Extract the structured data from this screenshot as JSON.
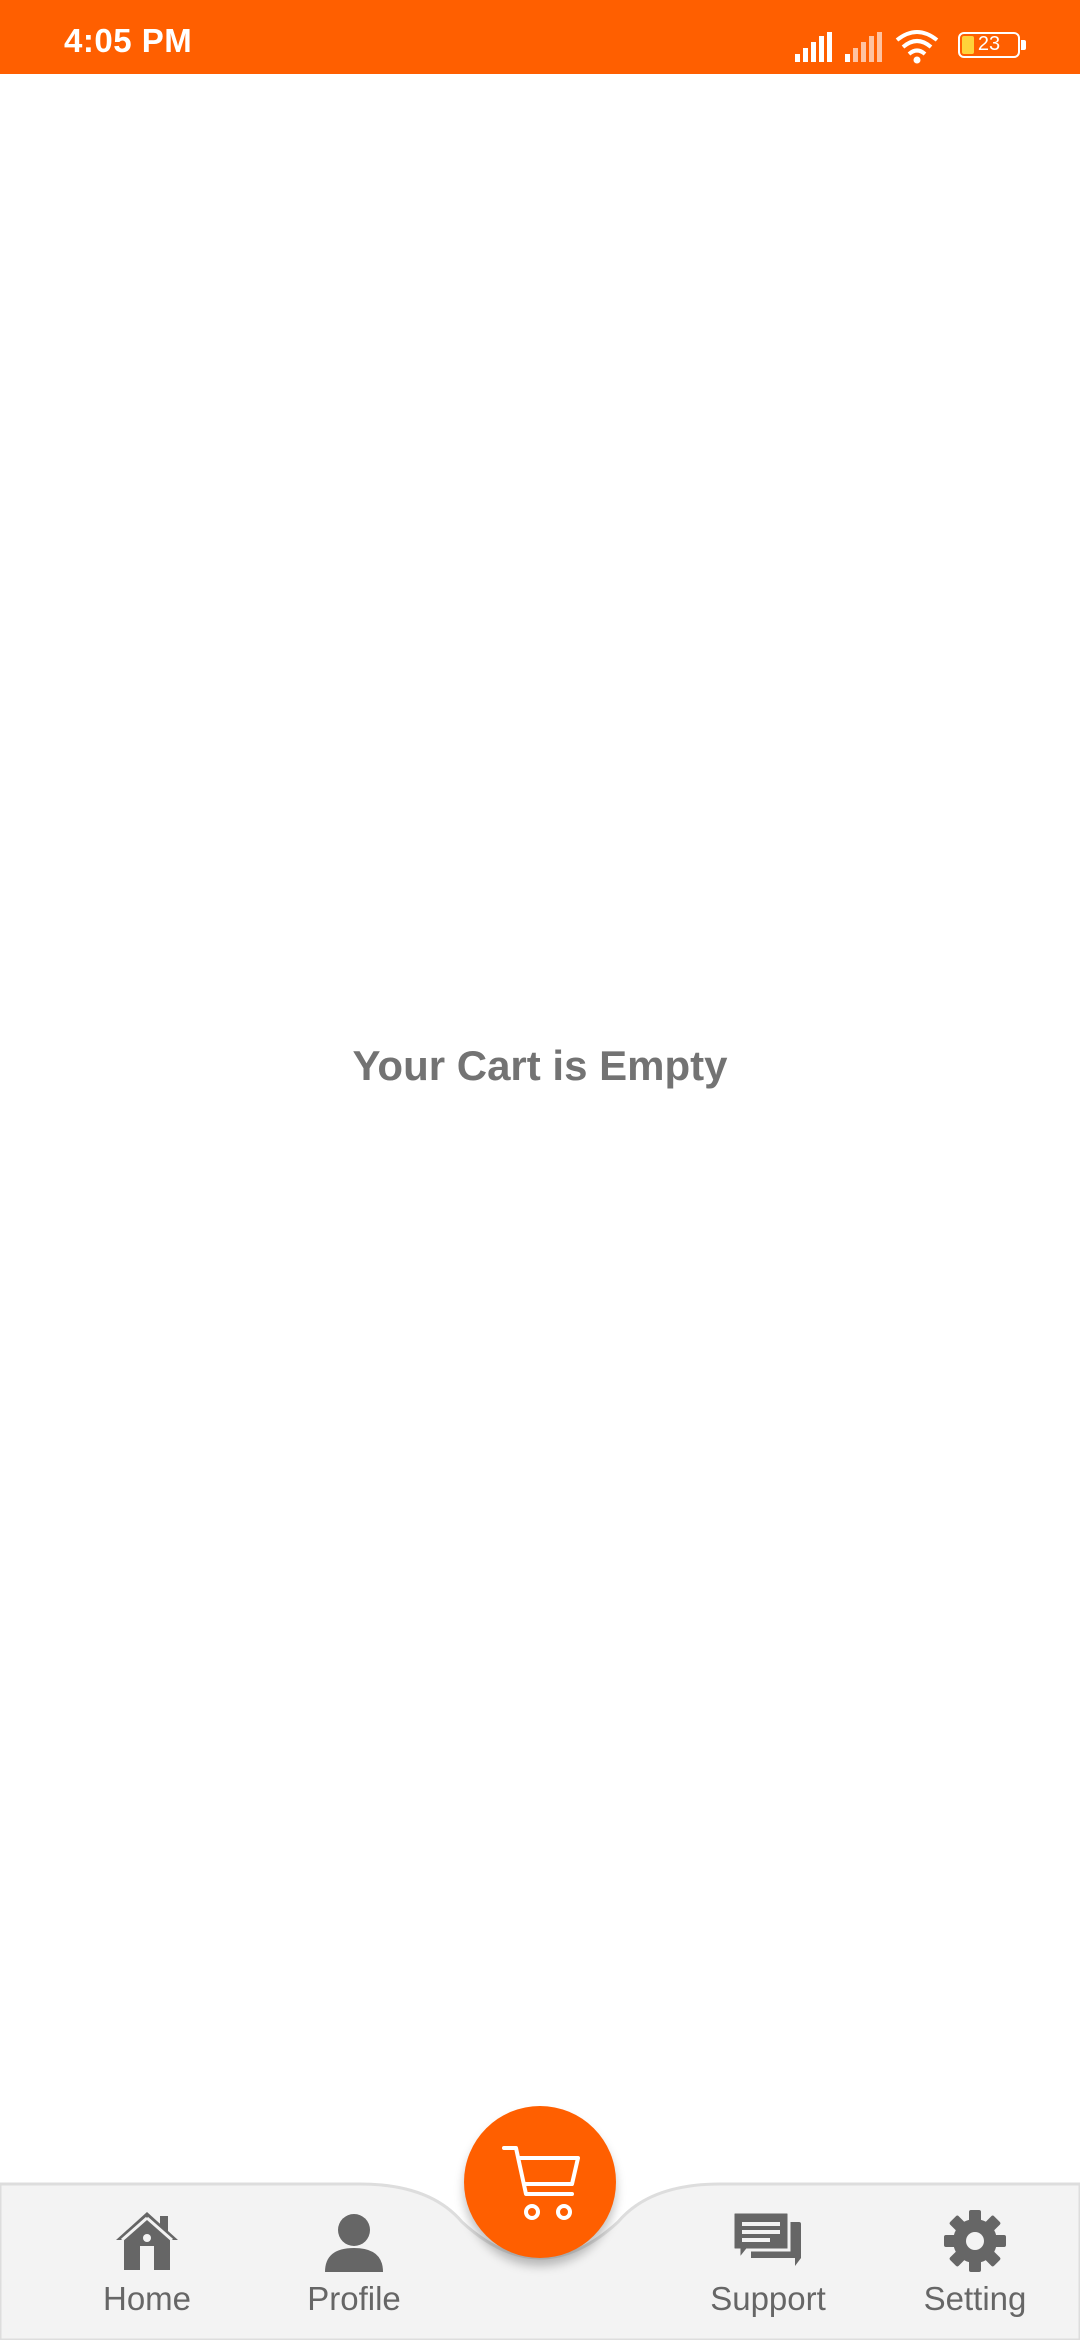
{
  "status_bar": {
    "time": "4:05 PM",
    "battery": "23",
    "icons": [
      "signal-icon",
      "signal-icon",
      "wifi-icon",
      "battery-icon"
    ],
    "color": "#ff5f00"
  },
  "main": {
    "empty_message": "Your Cart is Empty"
  },
  "bottom_nav": {
    "items": [
      {
        "label": "Home",
        "icon": "home-icon"
      },
      {
        "label": "Profile",
        "icon": "person-icon"
      },
      {
        "label": "Support",
        "icon": "chat-icon"
      },
      {
        "label": "Setting",
        "icon": "gear-icon"
      }
    ],
    "center_button_icon": "cart-icon",
    "accent_color": "#ff5f00",
    "icon_color": "#666666"
  }
}
